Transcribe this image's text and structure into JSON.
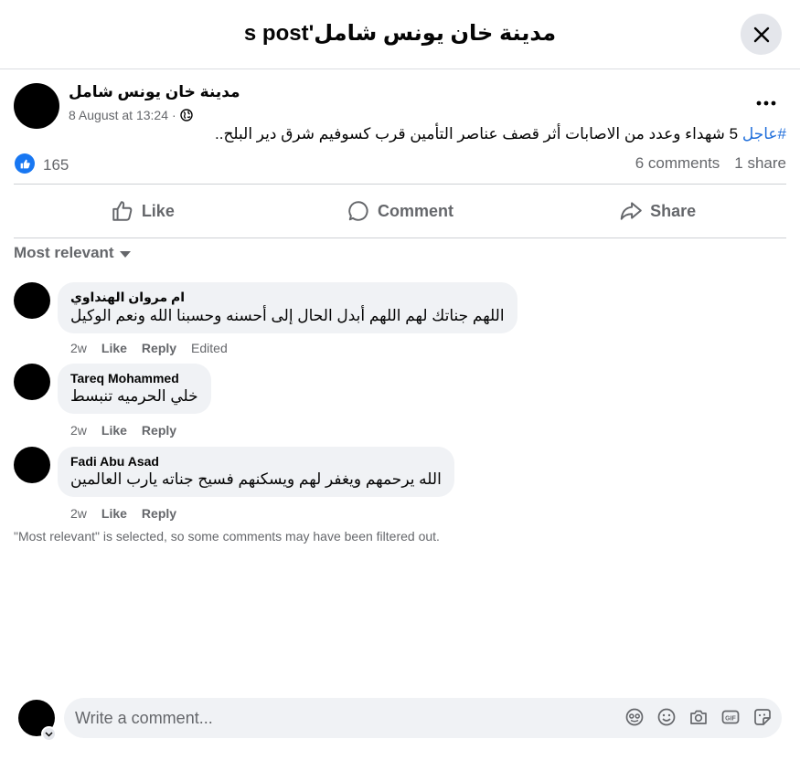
{
  "header": {
    "title": "مدينة خان يونس شامل's post"
  },
  "post": {
    "author": "مدينة خان يونس شامل",
    "date": "8 August at 13:24",
    "separator": "·",
    "hashtag": "#عاجل",
    "text": "5 شهداء وعدد من الاصابات أثر قصف عناصر التأمين قرب كسوفيم شرق دير البلح..",
    "likes": "165",
    "comments_count": "6 comments",
    "shares_count": "1 share"
  },
  "actions": {
    "like": "Like",
    "comment": "Comment",
    "share": "Share"
  },
  "sort": {
    "label": "Most relevant"
  },
  "comments": [
    {
      "author": "ام مروان الهنداوي",
      "text": "اللهم جناتك لهم اللهم أبدل الحال إلى أحسنه وحسبنا الله ونعم الوكيل",
      "time": "2w",
      "like": "Like",
      "reply": "Reply",
      "edited": "Edited"
    },
    {
      "author": "Tareq Mohammed",
      "text": "خلي الحرميه تنبسط",
      "time": "2w",
      "like": "Like",
      "reply": "Reply"
    },
    {
      "author": "Fadi Abu Asad",
      "text": "الله يرحمهم ويغفر لهم ويسكنهم فسيح جناته يارب العالمين",
      "time": "2w",
      "like": "Like",
      "reply": "Reply"
    }
  ],
  "filter_note": "\"Most relevant\" is selected, so some comments may have been filtered out.",
  "composer": {
    "placeholder": "Write a comment...",
    "icons": [
      "avatar-sticker-icon",
      "emoji-icon",
      "camera-icon",
      "gif-icon",
      "sticker-icon"
    ]
  },
  "colors": {
    "accent": "#1877f2",
    "hashtag": "#216fdb",
    "muted": "#65676b",
    "bubble": "#f0f2f5"
  }
}
